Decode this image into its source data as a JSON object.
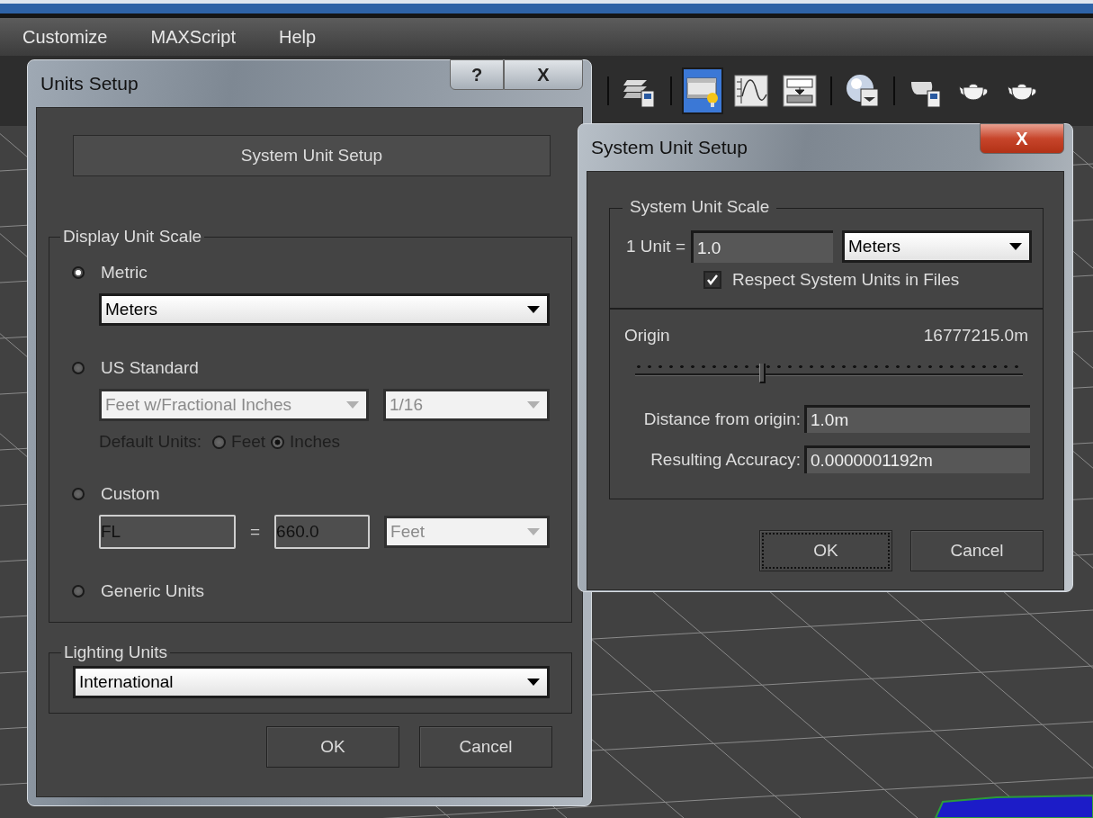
{
  "menu": [
    {
      "label": "Customize"
    },
    {
      "label": "MAXScript"
    },
    {
      "label": "Help"
    }
  ],
  "toolbar_groups": [
    [
      {
        "kind": "layers",
        "selected": false
      }
    ],
    [
      {
        "kind": "render_setup",
        "selected": true
      },
      {
        "kind": "curve",
        "selected": false
      },
      {
        "kind": "schematic",
        "selected": false
      }
    ],
    [
      {
        "kind": "material",
        "selected": false
      }
    ],
    [
      {
        "kind": "teapot_panel",
        "selected": false
      },
      {
        "kind": "teapot",
        "selected": false
      },
      {
        "kind": "teapot",
        "selected": false
      }
    ]
  ],
  "units_dialog": {
    "title": "Units Setup",
    "active": false,
    "help": "?",
    "close": "X",
    "system_button": "System Unit Setup",
    "display_scale": {
      "legend": "Display Unit Scale",
      "options": [
        {
          "label": "Metric",
          "selected": true,
          "dropdowns": [
            {
              "value": "Meters",
              "disabled": false
            }
          ]
        },
        {
          "label": "US Standard",
          "selected": false,
          "dropdowns": [
            {
              "value": "Feet w/Fractional Inches",
              "disabled": true
            },
            {
              "value": "1/16",
              "disabled": true
            }
          ],
          "default_units": {
            "label": "Default Units:",
            "disabled": true,
            "choices": [
              {
                "label": "Feet",
                "selected": false
              },
              {
                "label": "Inches",
                "selected": true
              }
            ]
          }
        },
        {
          "label": "Custom",
          "selected": false,
          "custom": {
            "fields": [
              {
                "value": "FL",
                "disabled": true
              },
              {
                "value": "660.0",
                "disabled": true
              }
            ],
            "equals": "=",
            "dropdown": {
              "value": "Feet",
              "disabled": true
            }
          }
        },
        {
          "label": "Generic Units",
          "selected": false
        }
      ]
    },
    "lighting": {
      "legend": "Lighting Units",
      "dropdown": {
        "value": "International",
        "disabled": false
      }
    },
    "buttons": [
      {
        "label": "OK",
        "focused": false
      },
      {
        "label": "Cancel",
        "focused": false
      }
    ]
  },
  "system_dialog": {
    "title": "System Unit Setup",
    "active": true,
    "close": "X",
    "scale": {
      "legend": "System Unit Scale",
      "unit_label": "1 Unit =",
      "unit_value": "1.0",
      "dropdown": {
        "value": "Meters",
        "disabled": false
      },
      "respect": {
        "label": "Respect System Units in Files",
        "checked": true
      }
    },
    "origin": {
      "label": "Origin",
      "value": "16777215.0m",
      "level": 0.33
    },
    "readouts": [
      {
        "label": "Distance from origin:",
        "value": "1.0m"
      },
      {
        "label": "Resulting Accuracy:",
        "value": "0.0000001192m"
      }
    ],
    "buttons": [
      {
        "label": "OK",
        "focused": true
      },
      {
        "label": "Cancel",
        "focused": false
      }
    ]
  }
}
